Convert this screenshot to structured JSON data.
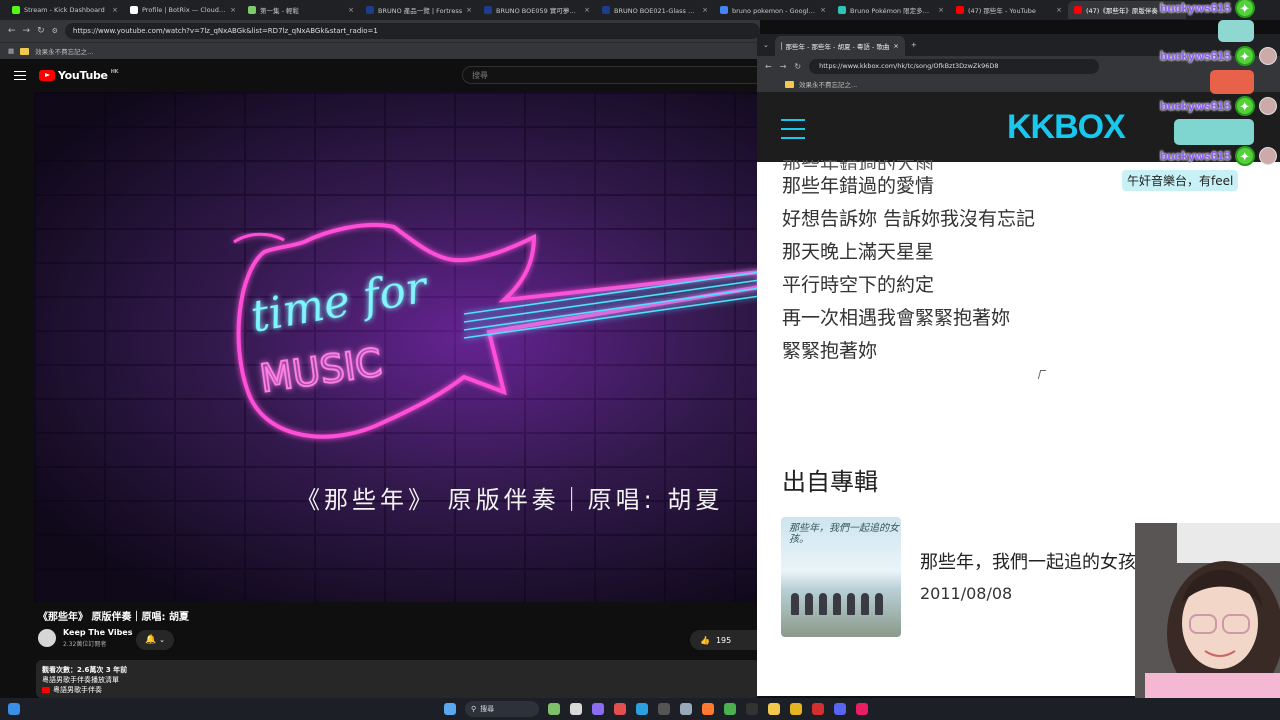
{
  "browser_tabs": [
    {
      "label": "Stream - Kick Dashboard",
      "color": "#53fc18"
    },
    {
      "label": "Profile | BotRix — Cloud Stre",
      "color": "#ffffff"
    },
    {
      "label": "第一集 - 輕鬆",
      "color": "#7ecb6a"
    },
    {
      "label": "BRUNO 產品一覽 | Fortress",
      "color": "#1e3c8c"
    },
    {
      "label": "BRUNO BOE059 實可夢限定",
      "color": "#1e3c8c"
    },
    {
      "label": "BRUNO BOE021-Glass 蒸焗",
      "color": "#1e3c8c"
    },
    {
      "label": "bruno pokemon - Google 搜",
      "color": "#4285f4"
    },
    {
      "label": "Bruno Pokémon 限定多功能",
      "color": "#2ec4b6"
    },
    {
      "label": "(47) 那些年 - YouTube",
      "color": "#ff0000"
    },
    {
      "label": "(47)《那些年》原版伴奏",
      "color": "#ff0000"
    }
  ],
  "youtube": {
    "url": "https://www.youtube.com/watch?v=7lz_qNxABGk&list=RD7lz_qNxABGk&start_radio=1",
    "bookmark": "效果永不費忘記之...",
    "logo_text": "YouTube",
    "region": "HK",
    "search_placeholder": "搜尋",
    "video_subtitle": "《那些年》 原版伴奏｜原唱: 胡夏",
    "neon_text_1": "time for",
    "neon_text_2": "MUSIC",
    "video_title": "《那些年》 原版伴奏｜原唱: 胡夏",
    "channel_name": "Keep The Vibes",
    "channel_subs": "2.32萬位訂閱者",
    "likes": "195",
    "desc_line1": "觀看次數：2.6萬次  3 年前",
    "desc_line2": "粵語男歌手伴奏播放清單",
    "desc_line3": "粵語男歌手伴奏"
  },
  "kkbox": {
    "tab_title": "那些年 - 那些年 - 胡夏 - 粵語 - 歌曲",
    "url": "https://www.kkbox.com/hk/tc/song/OfkBzt3DzwZk96D8",
    "bookmark": "效果永不費忘記之...",
    "logo": "KKBOX",
    "lyrics": [
      "那些年錯過的大雨",
      "那些年錯過的愛情",
      "好想告訴妳 告訴妳我沒有忘記",
      "那天晚上滿天星星",
      "平行時空下的約定",
      "再一次相遇我會緊緊抱著妳",
      "緊緊抱著妳"
    ],
    "album_section_title": "出自專輯",
    "album_cover_text": "那些年，我們一起追的女孩。",
    "album_name": "那些年，我們一起追的女孩",
    "album_date": "2011/08/08"
  },
  "chat": {
    "username": "buckyws615",
    "name_color": "#8a5cf6",
    "badge_color": "#53d13a",
    "message": "午奸音樂台，有feel"
  },
  "taskbar": {
    "search_label": "搜尋"
  }
}
